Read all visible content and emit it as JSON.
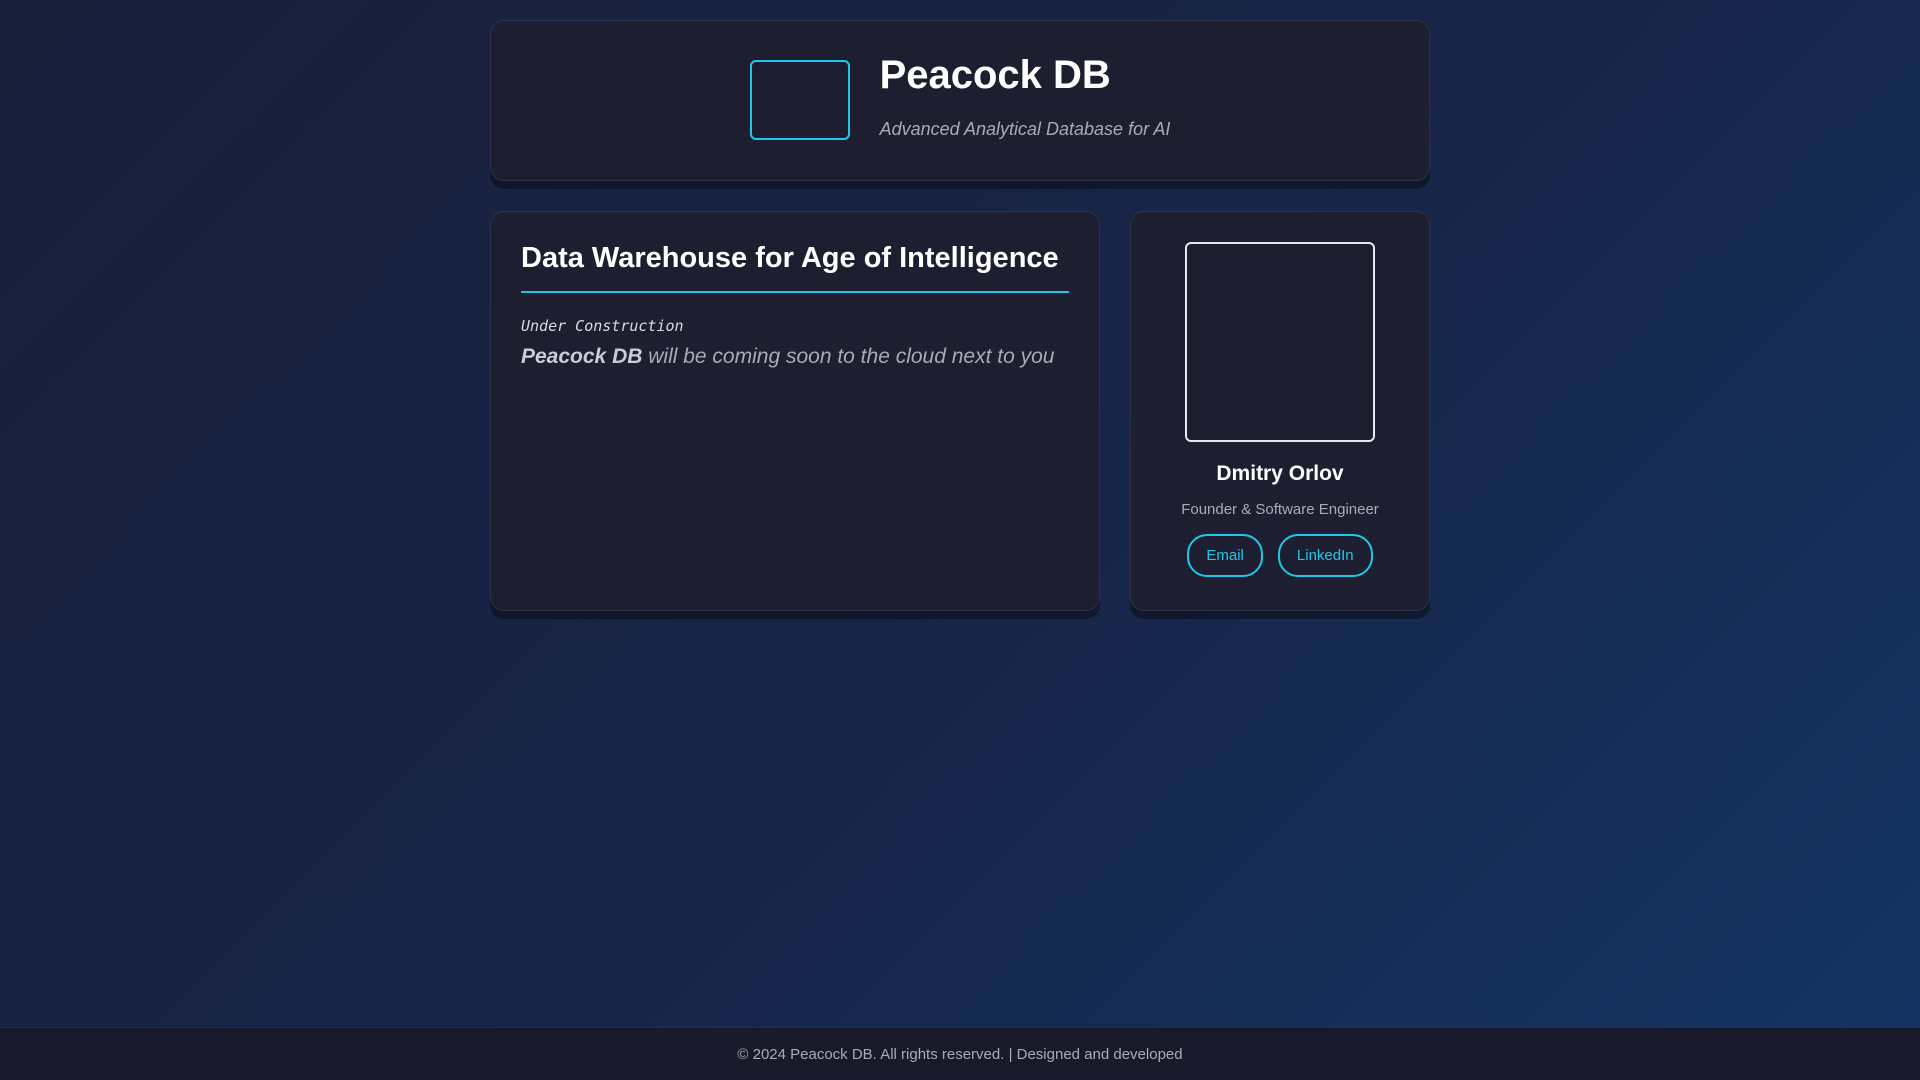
{
  "header": {
    "title": "Peacock DB",
    "tagline": "Advanced Analytical Database for AI"
  },
  "main": {
    "heading": "Data Warehouse for Age of Intelligence",
    "status": "Under Construction",
    "product_name": "Peacock DB",
    "description": " will be coming soon to the cloud next to you"
  },
  "profile": {
    "name": "Dmitry Orlov",
    "role": "Founder & Software Engineer",
    "email_label": "Email",
    "linkedin_label": "LinkedIn"
  },
  "footer": {
    "text": "© 2024 Peacock DB. All rights reserved. | Designed and developed"
  },
  "colors": {
    "accent": "#1ec8ea",
    "card": "#1d1f31",
    "background_start": "#1a1f3a",
    "background_end": "#133564"
  }
}
